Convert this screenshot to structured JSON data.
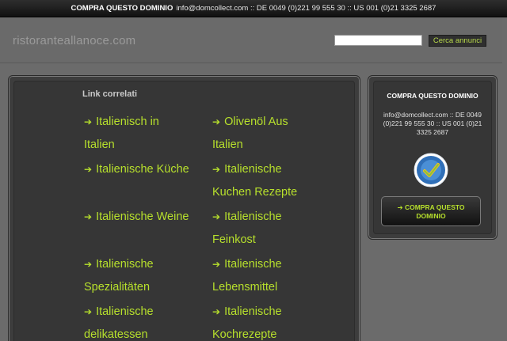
{
  "topbar": {
    "brand": "COMPRA QUESTO DOMINIO",
    "contact": "info@domcollect.com :: DE 0049 (0)221 99 555 30 :: US 001 (0)21 3325 2687"
  },
  "header": {
    "site_title": "ristoranteallanoce.com",
    "search_value": "",
    "search_button": "Cerca annunci"
  },
  "related": {
    "heading": "Link correlati",
    "col1": [
      {
        "line1": "Italienisch in",
        "line2": "Italien"
      },
      {
        "line1": "Italienische Küche",
        "line2": ""
      },
      {
        "line1": "Italienische Weine",
        "line2": ""
      },
      {
        "line1": "Italienische",
        "line2": "Spezialitäten"
      },
      {
        "line1": "Italienische",
        "line2": "delikatessen"
      }
    ],
    "col2": [
      {
        "line1": "Olivenöl Aus",
        "line2": "Italien"
      },
      {
        "line1": "Italienische",
        "line2": "Kuchen Rezepte"
      },
      {
        "line1": "Italienische",
        "line2": "Feinkost"
      },
      {
        "line1": "Italienische",
        "line2": "Lebensmittel"
      },
      {
        "line1": "Italienische",
        "line2": "Kochrezepte"
      }
    ],
    "arrow_icon": "arrow-right-icon"
  },
  "sidebar": {
    "title": "COMPRA QUESTO DOMINIO",
    "contact": "info@domcollect.com :: DE 0049 (0)221 99 555 30 :: US 001 (0)21 3325 2687",
    "badge_icon": "safe-secure-seal-icon",
    "buy_button": "COMPRA QUESTO DOMINIO"
  },
  "colors": {
    "accent": "#b7e02c",
    "background": "#6b6b6b",
    "panel": "#363636"
  }
}
